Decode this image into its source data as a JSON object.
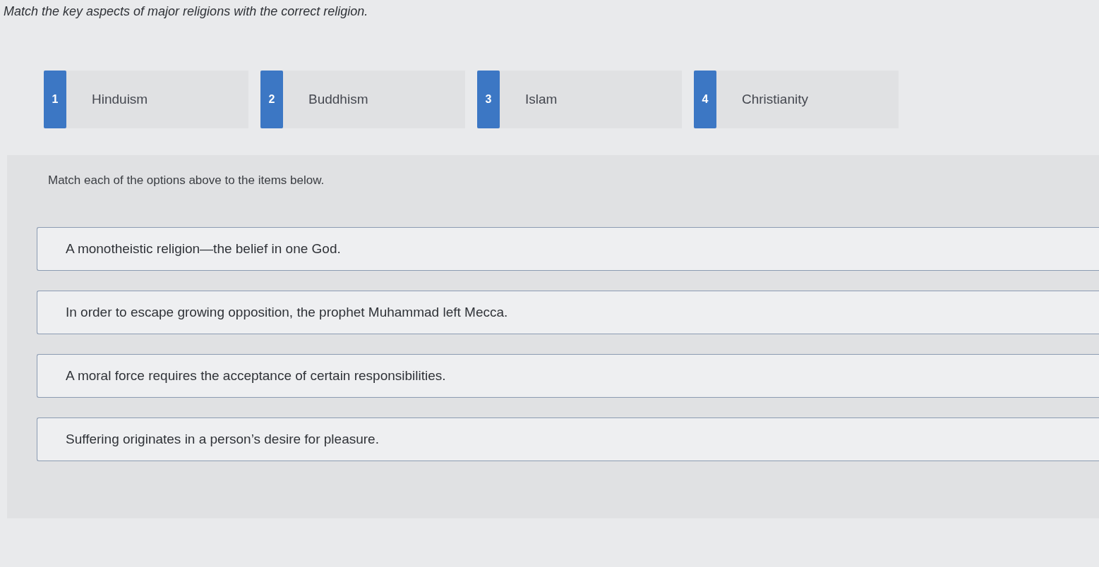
{
  "instruction": "Match the key aspects of major religions with the correct religion.",
  "options": [
    {
      "number": "1",
      "label": "Hinduism"
    },
    {
      "number": "2",
      "label": "Buddhism"
    },
    {
      "number": "3",
      "label": "Islam"
    },
    {
      "number": "4",
      "label": "Christianity"
    }
  ],
  "prompt": "Match each of the options above to the items below.",
  "items": [
    {
      "text": "A monotheistic religion—the belief in one God."
    },
    {
      "text": "In order to escape growing opposition, the prophet Muhammad left Mecca."
    },
    {
      "text": "A moral force requires the acceptance of certain responsibilities."
    },
    {
      "text": "Suffering originates in a person’s desire for pleasure."
    }
  ]
}
